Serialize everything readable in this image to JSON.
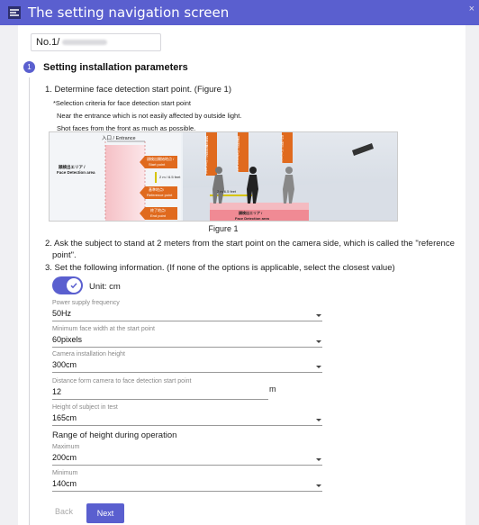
{
  "window": {
    "title": "The setting navigation screen",
    "close_glyph": "×"
  },
  "camera": {
    "label": "No.1/"
  },
  "step": {
    "number": "1",
    "title": "Setting installation parameters"
  },
  "instructions": {
    "item1": "1. Determine face detection start point. (Figure 1)",
    "criteria": "*Selection criteria for face detection start point",
    "note1": "Near the entrance which is not easily affected by outside light.",
    "note2": "Shot faces from the front as much as possible.",
    "item2_line1": "2. Ask the subject to stand at 2 meters from the start point on the camera side, which is called the \"reference",
    "item2_line2": "point\".",
    "item3": "3. Set the following information. (If none of the options is applicable, select the closest value)"
  },
  "figure": {
    "caption": "Figure 1",
    "entrance": "入口 / Entrance",
    "area_jp": "顔検出エリア /",
    "area_en": "Face Detection area",
    "start_jp": "顔検出開始地点 /",
    "start_en": "Start point",
    "distance": "2 m / 6.5 feet",
    "ref_jp": "基準地点/",
    "ref_en": "Reference point",
    "end_jp": "終了地点/",
    "end_en": "End point",
    "right_start": "顔検出開始地点 / Start point",
    "right_ref": "基準地点 / Reference point",
    "right_end": "終了地点 / End point",
    "right_distance": "2 m/6.5 feet",
    "right_area_jp": "顔検出エリア /",
    "right_area_en": "Face Detection area"
  },
  "unit": {
    "label": "Unit: cm",
    "enabled": true
  },
  "fields": {
    "power": {
      "label": "Power supply frequency",
      "value": "50Hz"
    },
    "min_face": {
      "label": "Minimum face width at the start point",
      "value": "60pixels"
    },
    "cam_height": {
      "label": "Camera installation height",
      "value": "300cm"
    },
    "distance": {
      "label": "Distance form camera to face detection start point",
      "value": "12",
      "unit": "m"
    },
    "subject_height": {
      "label": "Height of subject in test",
      "value": "165cm"
    },
    "range_label": "Range of height during operation",
    "maximum": {
      "label": "Maximum",
      "value": "200cm"
    },
    "minimum": {
      "label": "Minimum",
      "value": "140cm"
    }
  },
  "buttons": {
    "back": "Back",
    "next": "Next"
  },
  "colors": {
    "accent": "#5a5fcf",
    "arrow": "#e06a1e",
    "area": "#f4a0a8"
  }
}
